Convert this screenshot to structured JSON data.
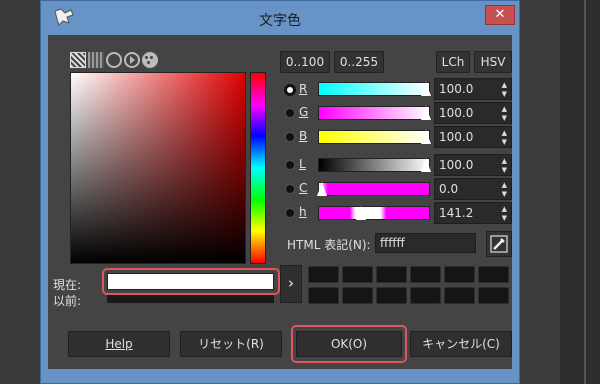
{
  "window": {
    "title": "文字色",
    "close_glyph": "✕"
  },
  "mode_icons": [
    "triangle-selector-icon",
    "watercolor-icon",
    "wheel-icon",
    "cmyk-icon",
    "palette-icon"
  ],
  "preview": {
    "current_label": "現在:",
    "old_label": "以前:",
    "current_color": "#ffffff",
    "arrow": "›"
  },
  "scale_buttons": [
    "0..100",
    "0..255"
  ],
  "model_buttons": [
    "LCh",
    "HSV"
  ],
  "channels": [
    {
      "label": "R",
      "value": "100.0",
      "selected": true
    },
    {
      "label": "G",
      "value": "100.0",
      "selected": false
    },
    {
      "label": "B",
      "value": "100.0",
      "selected": false
    },
    {
      "label": "L",
      "value": "100.0",
      "selected": false
    },
    {
      "label": "C",
      "value": "0.0",
      "selected": false
    },
    {
      "label": "h",
      "value": "141.2",
      "selected": false
    }
  ],
  "html": {
    "label": "HTML 表記(N):",
    "value": "ffffff"
  },
  "buttons": {
    "help": "Help",
    "reset": "リセット(R)",
    "ok": "OK(O)",
    "cancel": "キャンセル(C)"
  }
}
